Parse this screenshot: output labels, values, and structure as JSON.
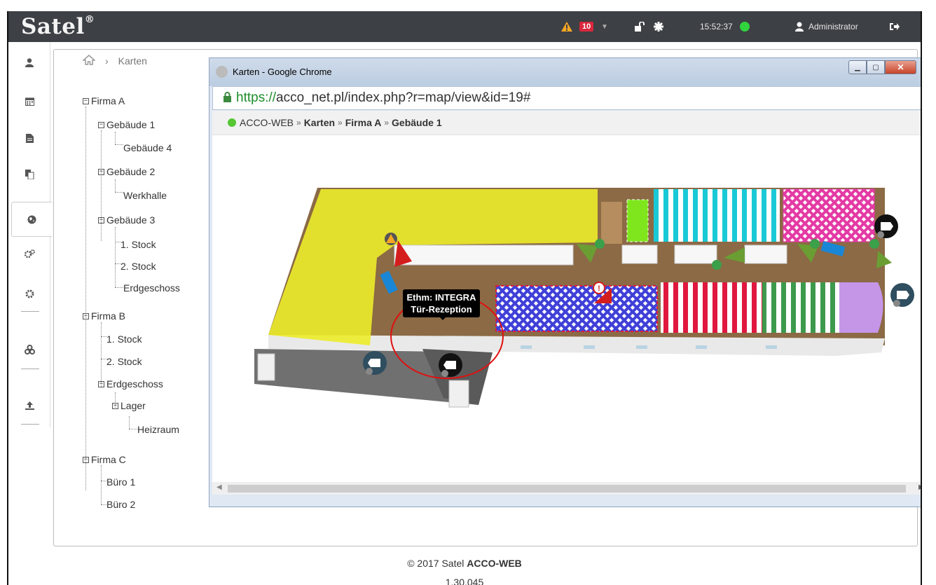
{
  "header": {
    "logo": "Satel",
    "logo_mark": "®",
    "alarm_count": "10",
    "time": "15:52:37",
    "user": "Administrator",
    "status_color": "#31d43c"
  },
  "rail": {
    "icons": [
      "user-icon",
      "calendar-icon",
      "document-icon",
      "copy-icon",
      "globe-icon",
      "cogs-icon",
      "gear-icon",
      "network-icon",
      "upload-icon"
    ]
  },
  "tree": {
    "breadcrumb": "Karten",
    "nodes": {
      "firma_a": "Firma A",
      "gebaeude_1": "Gebäude 1",
      "gebaeude_4": "Gebäude 4",
      "gebaeude_2": "Gebäude 2",
      "werkhalle": "Werkhalle",
      "gebaeude_3": "Gebäude 3",
      "stock_1_a": "1. Stock",
      "stock_2_a": "2. Stock",
      "erdgeschoss_a": "Erdgeschoss",
      "firma_b": "Firma B",
      "stock_1_b": "1. Stock",
      "stock_2_b": "2. Stock",
      "erdgeschoss_b": "Erdgeschoss",
      "lager": "Lager",
      "heizraum": "Heizraum",
      "firma_c": "Firma C",
      "buero_1": "Büro 1",
      "buero_2": "Büro 2"
    }
  },
  "chrome": {
    "title": "Karten - Google Chrome",
    "url_scheme": "https://",
    "url_rest": "acco_net.pl/index.php?r=map/view&id=19#",
    "crumbs": [
      "ACCO-WEB",
      "Karten",
      "Firma A",
      "Gebäude 1"
    ],
    "crumb_sep": "»"
  },
  "map": {
    "tooltip_line1": "Ethm: INTEGRA",
    "tooltip_line2": "Tür-Rezeption"
  },
  "footer": {
    "copyright": "© 2017 Satel",
    "product": "ACCO-WEB",
    "version": "1.30.045"
  }
}
